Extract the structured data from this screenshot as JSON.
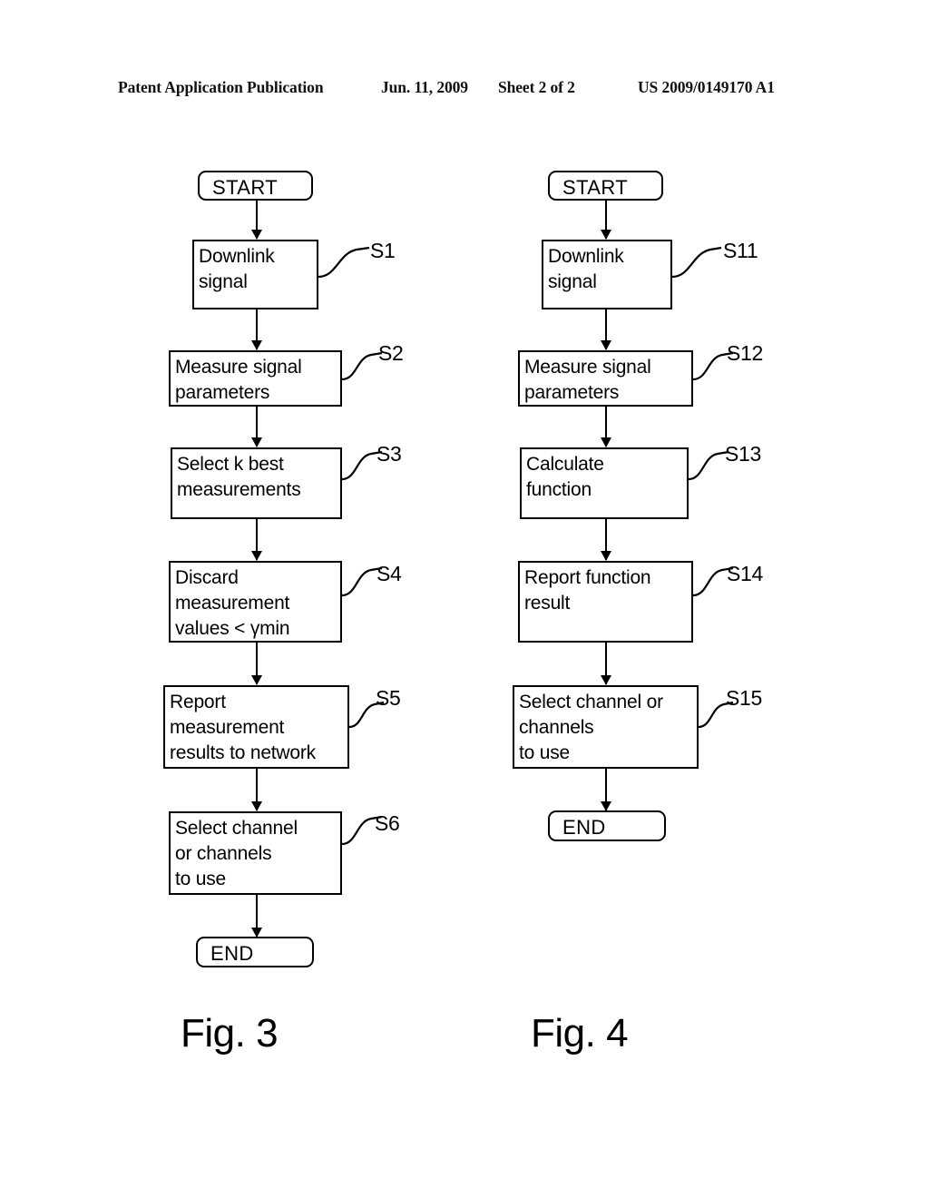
{
  "header": {
    "publication": "Patent Application Publication",
    "date": "Jun. 11, 2009",
    "sheet": "Sheet 2 of 2",
    "number": "US 2009/0149170 A1"
  },
  "figures": [
    {
      "caption": "Fig. 3",
      "start_label": "START",
      "end_label": "END",
      "steps": [
        {
          "id": "S1",
          "text": "Downlink\nsignal"
        },
        {
          "id": "S2",
          "text": "Measure signal\nparameters"
        },
        {
          "id": "S3",
          "text": "Select k best\nmeasurements"
        },
        {
          "id": "S4",
          "text": "Discard\nmeasurement\nvalues < γmin"
        },
        {
          "id": "S5",
          "text": "Report\nmeasurement\nresults to network"
        },
        {
          "id": "S6",
          "text": "Select channel\nor channels\nto use"
        }
      ]
    },
    {
      "caption": "Fig. 4",
      "start_label": "START",
      "end_label": "END",
      "steps": [
        {
          "id": "S11",
          "text": "Downlink\nsignal"
        },
        {
          "id": "S12",
          "text": "Measure signal\nparameters"
        },
        {
          "id": "S13",
          "text": "Calculate\nfunction"
        },
        {
          "id": "S14",
          "text": "Report function\nresult"
        },
        {
          "id": "S15",
          "text": "Select channel or\nchannels\nto use"
        }
      ]
    }
  ],
  "colors": {
    "ink": "#000000",
    "paper": "#ffffff"
  }
}
